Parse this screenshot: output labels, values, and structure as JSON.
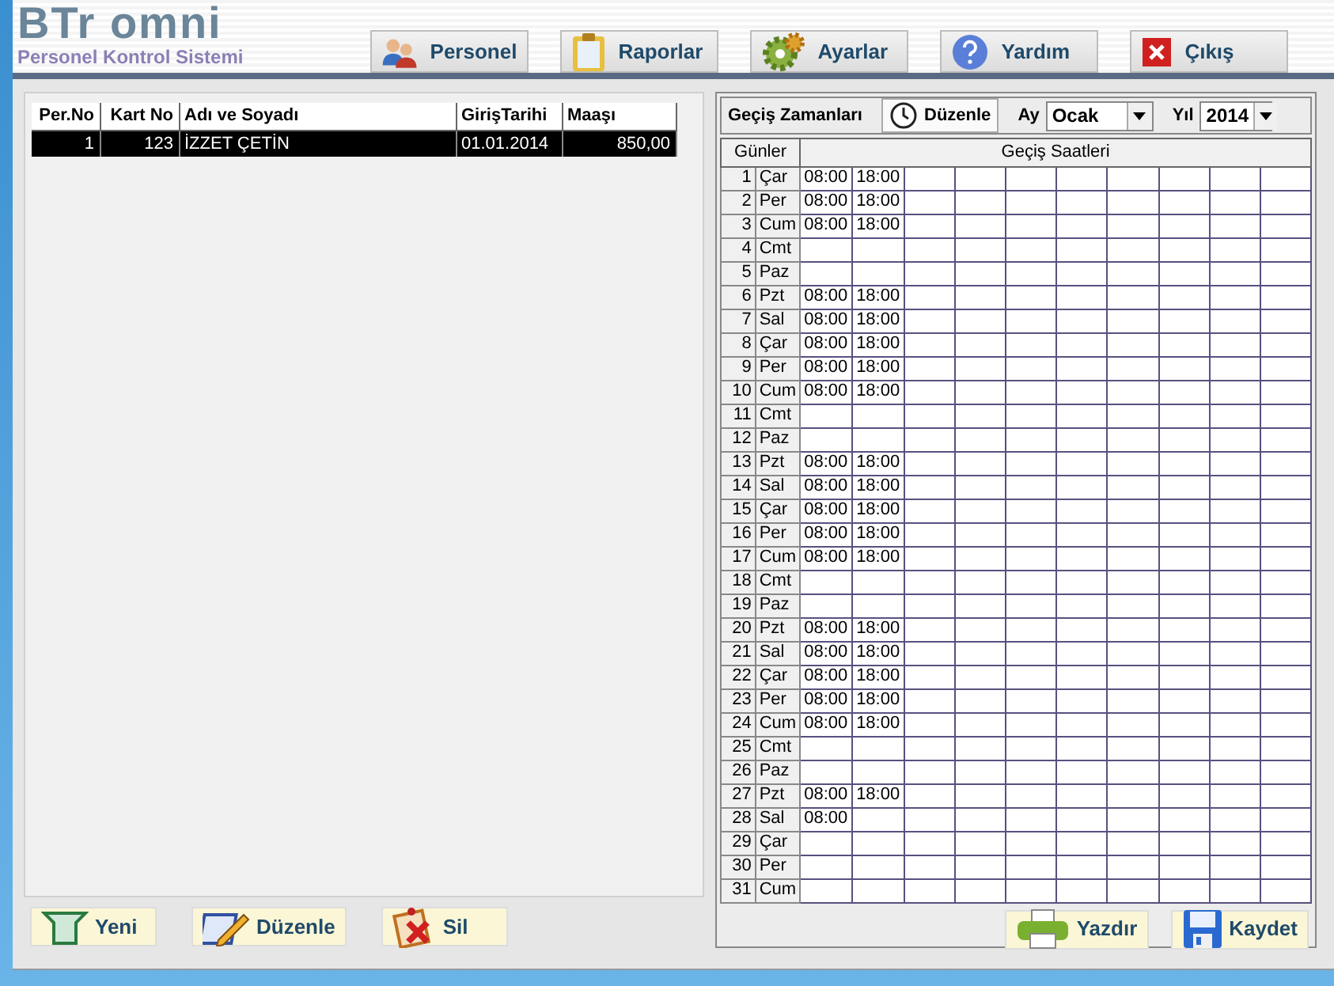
{
  "header": {
    "logo": "BTr omni",
    "subtitle": "Personel Kontrol Sistemi"
  },
  "nav": [
    {
      "label": "Personel"
    },
    {
      "label": "Raporlar"
    },
    {
      "label": "Ayarlar"
    },
    {
      "label": "Yardım"
    },
    {
      "label": "Çıkış"
    }
  ],
  "personnel": {
    "columns": [
      "Per.No",
      "Kart No",
      "Adı ve Soyadı",
      "GirişTarihi",
      "Maaşı"
    ],
    "rows": [
      {
        "cells": [
          "1",
          "123",
          "İZZET ÇETİN",
          "01.01.2014",
          "850,00"
        ],
        "selected": true
      }
    ]
  },
  "left_buttons": [
    {
      "label": "Yeni"
    },
    {
      "label": "Düzenle"
    },
    {
      "label": "Sil"
    }
  ],
  "times_panel": {
    "title": "Geçiş Zamanları",
    "edit_button": "Düzenle",
    "month_label": "Ay",
    "month": "Ocak",
    "year_label": "Yıl",
    "year": "2014",
    "columns": [
      "Günler",
      "Geçiş Saatleri"
    ],
    "days": [
      {
        "day": "1",
        "weekday": "Çar",
        "times": [
          "08:00",
          "18:00"
        ]
      },
      {
        "day": "2",
        "weekday": "Per",
        "times": [
          "08:00",
          "18:00"
        ]
      },
      {
        "day": "3",
        "weekday": "Cum",
        "times": [
          "08:00",
          "18:00"
        ]
      },
      {
        "day": "4",
        "weekday": "Cmt"
      },
      {
        "day": "5",
        "weekday": "Paz"
      },
      {
        "day": "6",
        "weekday": "Pzt",
        "times": [
          "08:00",
          "18:00"
        ]
      },
      {
        "day": "7",
        "weekday": "Sal",
        "times": [
          "08:00",
          "18:00"
        ]
      },
      {
        "day": "8",
        "weekday": "Çar",
        "times": [
          "08:00",
          "18:00"
        ]
      },
      {
        "day": "9",
        "weekday": "Per",
        "times": [
          "08:00",
          "18:00"
        ]
      },
      {
        "day": "10",
        "weekday": "Cum",
        "times": [
          "08:00",
          "18:00"
        ]
      },
      {
        "day": "11",
        "weekday": "Cmt"
      },
      {
        "day": "12",
        "weekday": "Paz"
      },
      {
        "day": "13",
        "weekday": "Pzt",
        "times": [
          "08:00",
          "18:00"
        ]
      },
      {
        "day": "14",
        "weekday": "Sal",
        "times": [
          "08:00",
          "18:00"
        ]
      },
      {
        "day": "15",
        "weekday": "Çar",
        "times": [
          "08:00",
          "18:00"
        ]
      },
      {
        "day": "16",
        "weekday": "Per",
        "times": [
          "08:00",
          "18:00"
        ]
      },
      {
        "day": "17",
        "weekday": "Cum",
        "times": [
          "08:00",
          "18:00"
        ]
      },
      {
        "day": "18",
        "weekday": "Cmt"
      },
      {
        "day": "19",
        "weekday": "Paz"
      },
      {
        "day": "20",
        "weekday": "Pzt",
        "times": [
          "08:00",
          "18:00"
        ]
      },
      {
        "day": "21",
        "weekday": "Sal",
        "times": [
          "08:00",
          "18:00"
        ]
      },
      {
        "day": "22",
        "weekday": "Çar",
        "times": [
          "08:00",
          "18:00"
        ]
      },
      {
        "day": "23",
        "weekday": "Per",
        "times": [
          "08:00",
          "18:00"
        ]
      },
      {
        "day": "24",
        "weekday": "Cum",
        "times": [
          "08:00",
          "18:00"
        ]
      },
      {
        "day": "25",
        "weekday": "Cmt"
      },
      {
        "day": "26",
        "weekday": "Paz"
      },
      {
        "day": "27",
        "weekday": "Pzt",
        "times": [
          "08:00",
          "18:00"
        ]
      },
      {
        "day": "28",
        "weekday": "Sal",
        "times": [
          "08:00"
        ]
      },
      {
        "day": "29",
        "weekday": "Çar"
      },
      {
        "day": "30",
        "weekday": "Per"
      },
      {
        "day": "31",
        "weekday": "Cum"
      }
    ],
    "buttons": [
      {
        "label": "Yazdır"
      },
      {
        "label": "Kaydet"
      }
    ]
  }
}
